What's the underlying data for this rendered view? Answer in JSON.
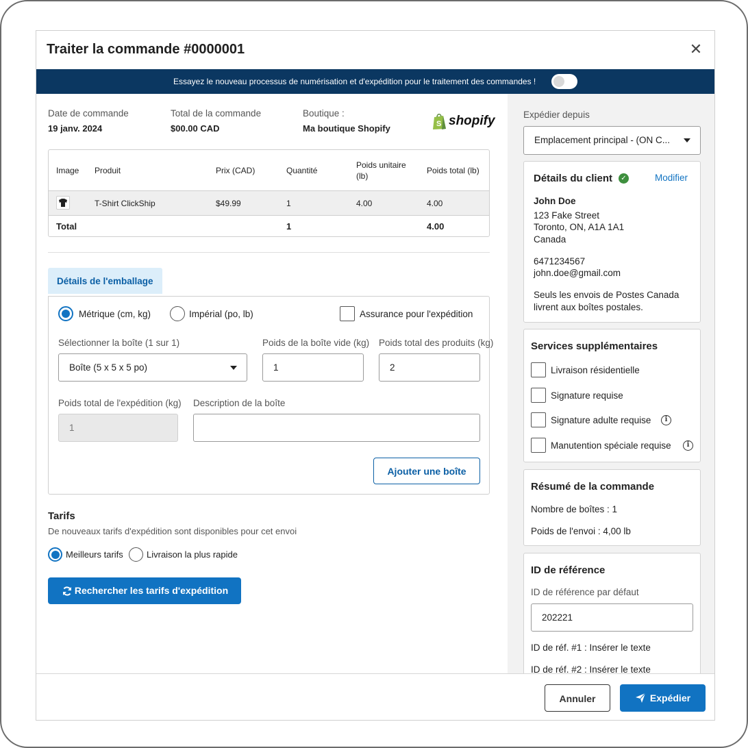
{
  "modal": {
    "title": "Traiter la commande #0000001",
    "close_label": "✕"
  },
  "banner": {
    "text": "Essayez le nouveau processus de numérisation et d'expédition pour le traitement des commandes !"
  },
  "order": {
    "date_label": "Date de commande",
    "date_value": "19 janv. 2024",
    "total_label": "Total de la commande",
    "total_value": "$00.00 CAD",
    "shop_label": "Boutique :",
    "shop_value": "Ma boutique Shopify",
    "shop_logo_text": "shopify"
  },
  "products_table": {
    "headers": {
      "image": "Image",
      "product": "Produit",
      "price": "Prix (CAD)",
      "quantity": "Quantité",
      "unit_weight_l1": "Poids unitaire",
      "unit_weight_l2": "(lb)",
      "total_weight": "Poids total (lb)"
    },
    "rows": [
      {
        "product": "T-Shirt ClickShip",
        "price": "$49.99",
        "quantity": "1",
        "unit_weight": "4.00",
        "total_weight": "4.00"
      }
    ],
    "total": {
      "label": "Total",
      "quantity": "1",
      "total_weight": "4.00"
    }
  },
  "packaging": {
    "tab_label": "Détails de l'emballage",
    "metric_label": "Métrique (cm, kg)",
    "imperial_label": "Impérial (po, lb)",
    "insurance_label": "Assurance pour l'expédition",
    "box_select_label": "Sélectionner la boîte (1 sur 1)",
    "box_select_value": "Boîte (5 x 5 x 5 po)",
    "empty_weight_label": "Poids de la boîte vide (kg)",
    "empty_weight_value": "1",
    "products_weight_label": "Poids total des produits (kg)",
    "products_weight_value": "2",
    "shipment_weight_label": "Poids total de l'expédition (kg)",
    "shipment_weight_value": "1",
    "description_label": "Description de la boîte",
    "description_value": "",
    "add_box_label": "Ajouter une boîte"
  },
  "rates": {
    "title": "Tarifs",
    "subtitle": "De nouveaux tarifs d'expédition sont disponibles pour cet envoi",
    "best_label": "Meilleurs tarifs",
    "fastest_label": "Livraison la plus rapide",
    "search_label": "Rechercher les tarifs d'expédition"
  },
  "ship_from": {
    "label": "Expédier depuis",
    "value": "Emplacement principal - (ON C..."
  },
  "customer": {
    "title": "Détails du client",
    "edit_label": "Modifier",
    "name": "John Doe",
    "street": "123 Fake Street",
    "city": "Toronto, ON, A1A 1A1",
    "country": "Canada",
    "phone": "6471234567",
    "email": "john.doe@gmail.com",
    "note_l1": "Seuls les envois de Postes Canada",
    "note_l2": "livrent aux boîtes postales."
  },
  "extra_services": {
    "title": "Services supplémentaires",
    "items": [
      {
        "label": "Livraison résidentielle"
      },
      {
        "label": "Signature requise"
      },
      {
        "label": "Signature adulte requise"
      },
      {
        "label": "Manutention spéciale requise"
      }
    ]
  },
  "summary": {
    "title": "Résumé de la commande",
    "boxes": "Nombre de boîtes : 1",
    "weight": "Poids de l'envoi : 4,00 lb"
  },
  "reference": {
    "title": "ID de référence",
    "default_label": "ID de référence par défaut",
    "default_value": "202221",
    "ref1": "ID de réf. #1 : Insérer le texte",
    "ref2": "ID de réf. #2 : Insérer le texte"
  },
  "footer": {
    "cancel_label": "Annuler",
    "ship_label": "Expédier"
  },
  "colors": {
    "banner": "#0b3761",
    "primary": "#1173c2",
    "tab_bg": "#dceefa",
    "success": "#3e8f3e",
    "shopify_green": "#95bf47"
  }
}
